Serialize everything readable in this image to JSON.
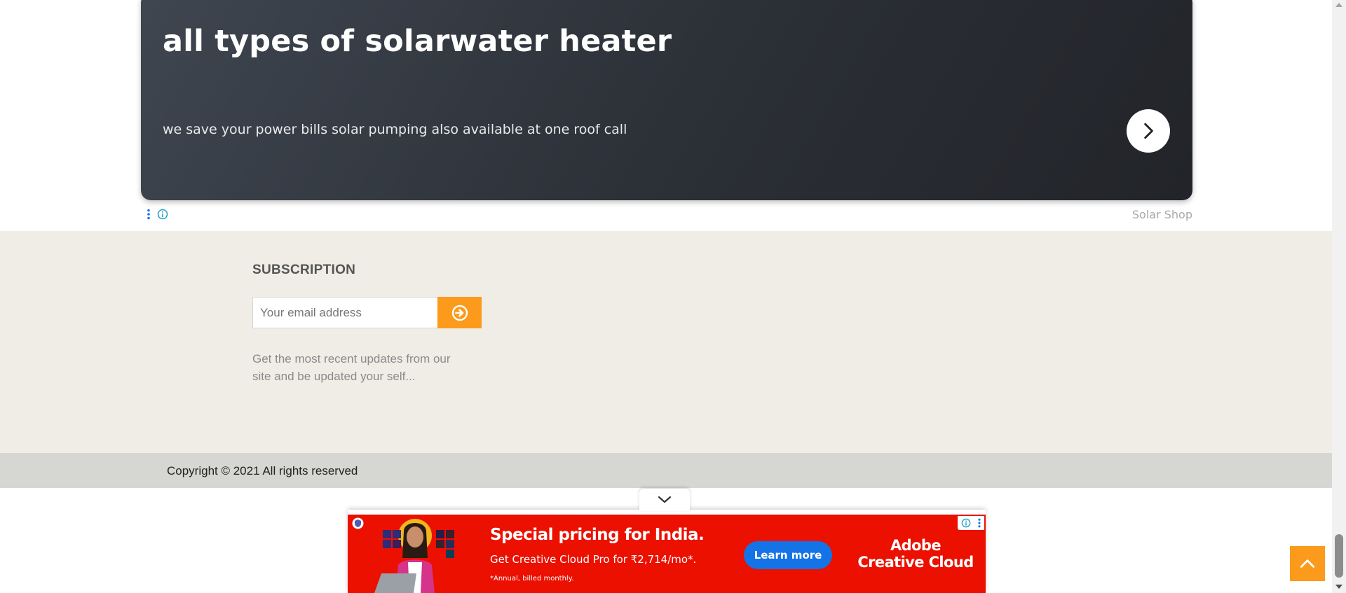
{
  "ad_card": {
    "title": "all types of solarwater heater",
    "subtitle": "we save your power bills solar pumping also available at one roof call",
    "next_icon": "chevron-right-icon",
    "source": "Solar Shop"
  },
  "subscription": {
    "heading": "SUBSCRIPTION",
    "email_placeholder": "Your email address",
    "submit_icon": "arrow-circle-right-icon",
    "description": "Get the most recent updates from our site and be updated your self..."
  },
  "footer": {
    "copyright": "Copyright © 2021 All rights reserved"
  },
  "anchor_ad": {
    "collapse_icon": "chevron-down-icon",
    "headline": "Special pricing for India.",
    "offer": "Get Creative Cloud Pro for ₹2,714/mo*.",
    "fine_print": "*Annual, billed monthly.",
    "cta": "Learn more",
    "brand_line1": "Adobe",
    "brand_line2": "Creative Cloud"
  },
  "colors": {
    "accent_orange": "#fb9a1b",
    "banner_red": "#eb1000",
    "cta_blue": "#1473e6",
    "section_bg": "#efede6",
    "footer_bg": "#d6d7d2"
  }
}
